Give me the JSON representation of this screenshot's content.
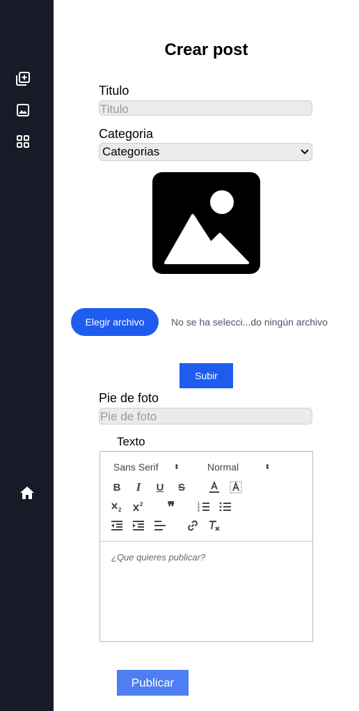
{
  "sidebar": {
    "icons": [
      "add-post-icon",
      "image-icon",
      "grid-icon",
      "home-icon"
    ]
  },
  "page": {
    "title": "Crear post"
  },
  "form": {
    "title_label": "Titulo",
    "title_placeholder": "Titulo",
    "category_label": "Categoria",
    "category_selected": "Categorias",
    "file_button": "Elegir archivo",
    "file_status": "No se ha selecci...do ningún archivo",
    "upload_button": "Subir",
    "caption_label": "Pie de foto",
    "caption_placeholder": "Pie de foto",
    "text_label": "Texto"
  },
  "editor": {
    "font": "Sans Serif",
    "size": "Normal",
    "placeholder": "¿Que quieres publicar?",
    "buttons": {
      "bold": "B",
      "italic": "I",
      "underline": "U",
      "strike": "S",
      "quote": "❞"
    }
  },
  "publish_button": "Publicar",
  "colors": {
    "sidebar_bg": "#161b27",
    "primary": "#1e5bef",
    "publish": "#4d7ef2"
  }
}
